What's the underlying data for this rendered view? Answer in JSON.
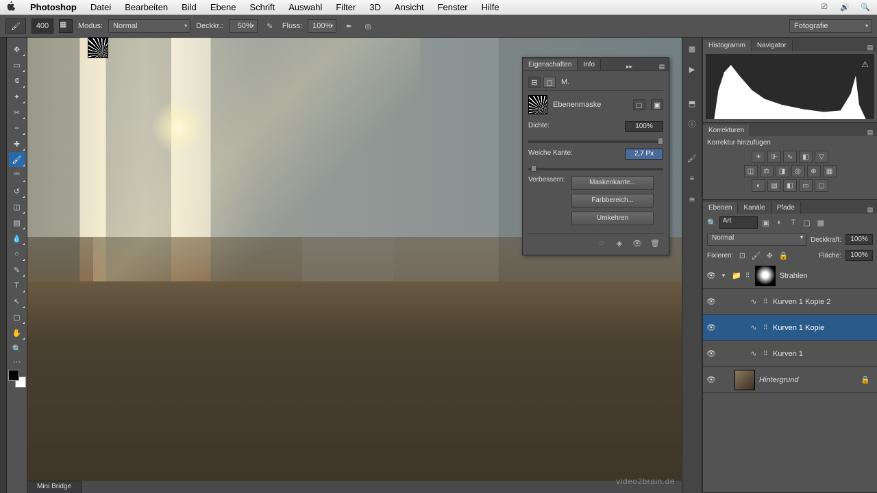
{
  "menubar": {
    "app": "Photoshop",
    "items": [
      "Datei",
      "Bearbeiten",
      "Bild",
      "Ebene",
      "Schrift",
      "Auswahl",
      "Filter",
      "3D",
      "Ansicht",
      "Fenster",
      "Hilfe"
    ]
  },
  "options": {
    "brush_size": "400",
    "mode_label": "Modus:",
    "mode_value": "Normal",
    "opacity_label": "Deckkr.:",
    "opacity_value": "50%",
    "flow_label": "Fluss:",
    "flow_value": "100%",
    "workspace": "Fotografie"
  },
  "props": {
    "tab1": "Eigenschaften",
    "tab2": "Info",
    "mode_label": "M.",
    "mask_label": "Ebenenmaske",
    "density_label": "Dichte:",
    "density_value": "100%",
    "feather_label": "Weiche Kante:",
    "feather_value": "2,7 Px",
    "refine_label": "Verbessern:",
    "btn_mask_edge": "Maskenkante...",
    "btn_color_range": "Farbbereich...",
    "btn_invert": "Umkehren"
  },
  "panels": {
    "histogram": "Histogramm",
    "navigator": "Navigator",
    "korrekturen": "Korrekturen",
    "korrektur_add": "Korrektur hinzufügen",
    "ebenen": "Ebenen",
    "kanale": "Kanäle",
    "pfade": "Pfade"
  },
  "layers_opts": {
    "filter": "Art",
    "blend": "Normal",
    "opacity_label": "Deckkraft:",
    "opacity_value": "100%",
    "lock_label": "Fixieren:",
    "fill_label": "Fläche:",
    "fill_value": "100%"
  },
  "layers": [
    {
      "name": "Strahlen"
    },
    {
      "name": "Kurven 1 Kopie 2"
    },
    {
      "name": "Kurven 1 Kopie"
    },
    {
      "name": "Kurven 1"
    },
    {
      "name": "Hintergrund"
    }
  ],
  "footer": {
    "mini_bridge": "Mini Bridge"
  },
  "watermark": "video2brain.de"
}
